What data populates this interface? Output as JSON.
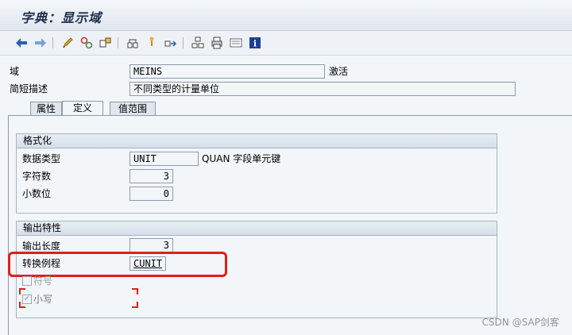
{
  "window": {
    "title": "字典：显示域"
  },
  "toolbar": {
    "icons": [
      "back-arrow-icon",
      "forward-arrow-icon",
      "edit-pencil-icon",
      "other-object-icon",
      "hierarchy-icon",
      "where-used-icon",
      "pin-icon",
      "navigate-icon",
      "display-object-list-icon",
      "print-icon",
      "screen-icon",
      "info-icon"
    ]
  },
  "header": {
    "domain_label": "域",
    "domain_value": "MEINS",
    "status": "激活",
    "short_desc_label": "简短描述",
    "short_desc_value": "不同类型的计量单位"
  },
  "tabs": [
    {
      "label": "属性"
    },
    {
      "label": "定义"
    },
    {
      "label": "值范围"
    }
  ],
  "format_group": {
    "title": "格式化",
    "data_type_label": "数据类型",
    "data_type_value": "UNIT",
    "data_type_desc": "QUAN 字段单元键",
    "length_label": "字符数",
    "length_value": "3",
    "decimals_label": "小数位",
    "decimals_value": "0"
  },
  "output_group": {
    "title": "输出特性",
    "output_length_label": "输出长度",
    "output_length_value": "3",
    "conversion_label": "转换例程",
    "conversion_value": "CUNIT",
    "sign_label": "符号",
    "lowercase_label": "小写"
  },
  "watermark": "CSDN @SAP剑客",
  "colors": {
    "highlight": "#e41c1c",
    "panel_bg": "#f3f6f9",
    "field_border": "#8c9bb0"
  }
}
